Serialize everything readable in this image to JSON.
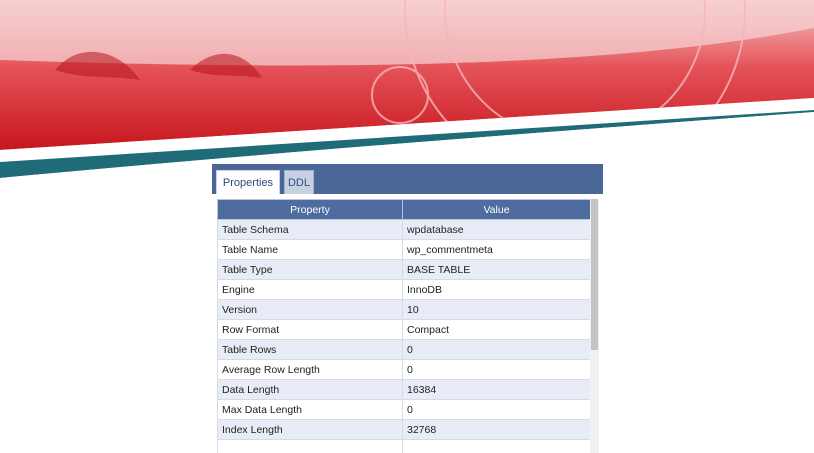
{
  "tabs": [
    {
      "label": "Properties",
      "active": true
    },
    {
      "label": "DDL",
      "active": false
    }
  ],
  "grid": {
    "headers": [
      "Property",
      "Value"
    ],
    "rows": [
      {
        "property": "Table Schema",
        "value": "wpdatabase"
      },
      {
        "property": "Table Name",
        "value": "wp_commentmeta"
      },
      {
        "property": "Table Type",
        "value": "BASE TABLE"
      },
      {
        "property": "Engine",
        "value": "InnoDB"
      },
      {
        "property": "Version",
        "value": "10"
      },
      {
        "property": "Row Format",
        "value": "Compact"
      },
      {
        "property": "Table Rows",
        "value": "0"
      },
      {
        "property": "Average Row Length",
        "value": "0"
      },
      {
        "property": "Data Length",
        "value": "16384"
      },
      {
        "property": "Max Data Length",
        "value": "0"
      },
      {
        "property": "Index Length",
        "value": "32768"
      },
      {
        "property": "",
        "value": ""
      }
    ]
  },
  "colors": {
    "banner_red": "#d9252b",
    "banner_teal": "#1f6c78",
    "tabbar_blue": "#4a6797",
    "header_blue": "#4f6ca0",
    "row_alt": "#e8ecf6"
  }
}
